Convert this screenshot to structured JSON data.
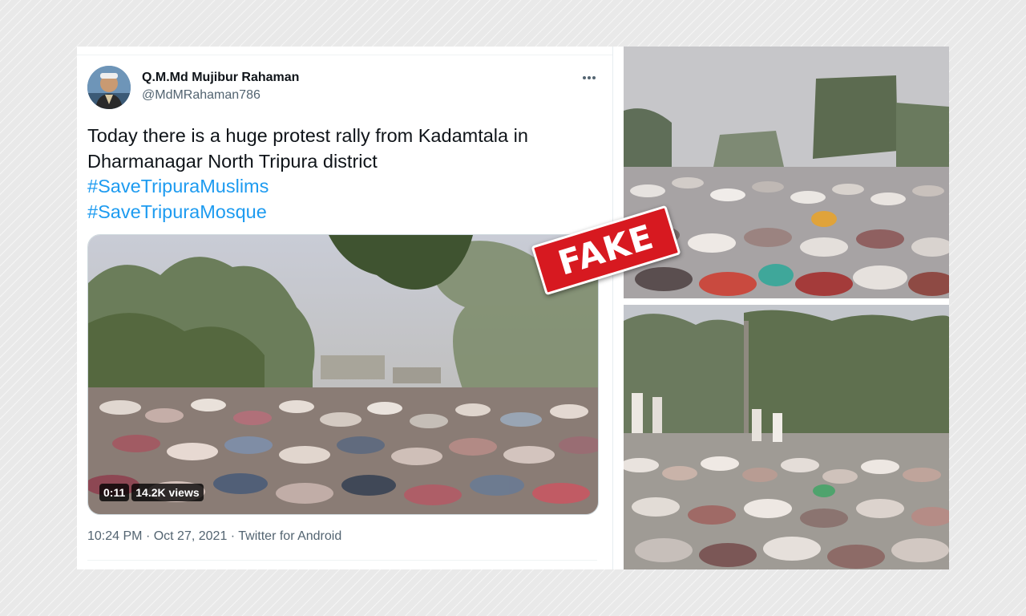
{
  "tweet": {
    "display_name": "Q.M.Md Mujibur Rahaman",
    "handle": "@MdMRahaman786",
    "text_line_1": "Today there is a huge protest rally from Kadamtala in",
    "text_line_2": "Dharmanagar North Tripura district",
    "hashtags": [
      "#SaveTripuraMuslims",
      "#SaveTripuraMosque"
    ],
    "video": {
      "duration": "0:11",
      "views": "14.2K views"
    },
    "meta": {
      "time": "10:24 PM",
      "date": "Oct 27, 2021",
      "separator": "·",
      "source": "Twitter for Android"
    },
    "icons": {
      "more": "more-horizontal-icon",
      "avatar": "user-avatar"
    }
  },
  "stamp": {
    "label": "FAKE",
    "color": "#d71920"
  },
  "colors": {
    "link": "#1d9bf0",
    "text": "#0f1419",
    "muted": "#536471"
  }
}
